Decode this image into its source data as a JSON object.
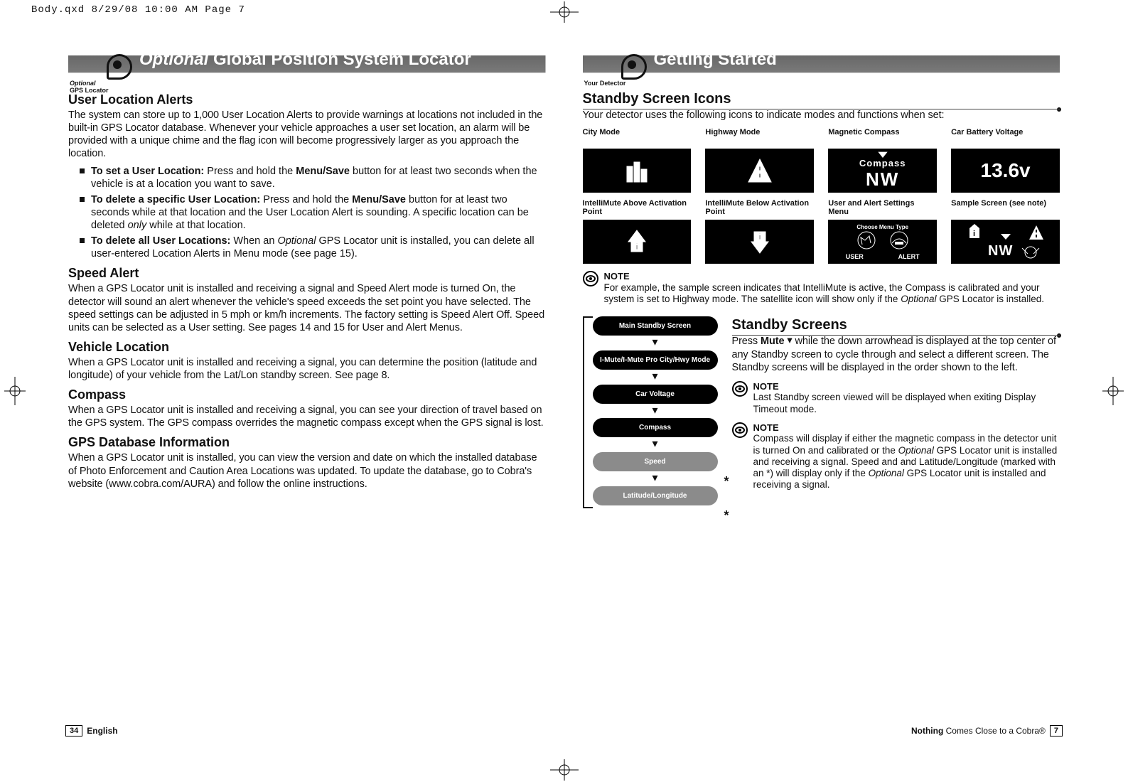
{
  "slug": "Body.qxd  8/29/08  10:00 AM  Page 7",
  "left": {
    "header_prefix_italic": "Optional",
    "header_rest": " Global Position System Locator",
    "header_caption_italic": "Optional",
    "header_caption_rest": "GPS Locator",
    "s1_title": "User Location Alerts",
    "s1_intro": "The system can store up to 1,000 User Location Alerts to provide warnings at locations not included in the built-in GPS Locator database. Whenever your vehicle approaches a user set location, an alarm will be provided with a unique chime and the flag icon will become progressively larger as you approach the location.",
    "s1_items": [
      {
        "lead": "To set a User Location:",
        "rest": " Press and hold the ",
        "mid_b": "Menu/Save",
        "rest2": " button for at least two seconds when the vehicle is at a location you want to save."
      },
      {
        "lead": "To delete a specific User Location:",
        "rest": " Press and hold the ",
        "mid_b": "Menu/Save",
        "rest2": " button for at least two seconds while at that location and the User Location Alert is sounding. A specific location can be deleted ",
        "ital": "only",
        "rest3": " while at that location."
      },
      {
        "lead": "To delete all User Locations:",
        "rest": " When an ",
        "ital": "Optional",
        "rest2": " GPS Locator unit is installed, you can delete all user-entered Location Alerts in Menu mode (see  page 15)."
      }
    ],
    "s2_title": "Speed Alert",
    "s2_body": "When a GPS Locator unit is installed and receiving a signal and Speed Alert mode is turned On, the detector will sound an alert whenever the vehicle's speed exceeds the set point you have selected. The speed settings can be adjusted in 5 mph or km/h increments. The factory setting is Speed Alert Off. Speed units can be selected as a User setting. See pages 14 and 15 for User and Alert Menus.",
    "s3_title": "Vehicle Location",
    "s3_body": "When a GPS Locator unit is installed and receiving a signal, you can determine the position (latitude and longitude) of your vehicle from the Lat/Lon standby screen. See page 8.",
    "s4_title": "Compass",
    "s4_body": "When a GPS Locator unit is installed and receiving a signal, you can see your direction of travel based on the GPS system. The GPS compass overrides the magnetic compass except when the GPS signal is lost.",
    "s5_title": "GPS Database Information",
    "s5_body": "When a GPS Locator unit is installed, you can view the version and date on which the installed database of Photo Enforcement and Caution Area Locations was updated. To update the database, go to Cobra's website (www.cobra.com/AURA) and follow the online instructions.",
    "footer_page": "34",
    "footer_lang": "English"
  },
  "right": {
    "header_title": "Getting Started",
    "header_caption": "Your Detector",
    "h1": "Standby Screen Icons",
    "h1_sub": "Your detector uses the following icons to indicate modes and functions when set:",
    "icons": {
      "city": "City Mode",
      "highway": "Highway Mode",
      "mag_compass": "Magnetic Compass",
      "battery": "Car Battery Voltage",
      "battery_value": "13.6v",
      "compass_lbl": "Compass",
      "compass_dir": "NW",
      "imute_above": "IntelliMute Above Activation Point",
      "imute_below": "IntelliMute Below Activation Point",
      "user_alert": "User and Alert Settings  Menu",
      "sample": "Sample Screen (see note)",
      "choose": "Choose Menu Type",
      "user_lbl": "USER",
      "alert_lbl": "ALERT"
    },
    "note1_hdr": "NOTE",
    "note1_body_a": "For example, the sample screen indicates that IntelliMute is active, the Compass is calibrated and your system is set to Highway mode. The satellite icon will show only if the ",
    "note1_body_ital": "Optional",
    "note1_body_b": " GPS Locator is installed.",
    "h2": "Standby Screens",
    "h2_body_a": "Press ",
    "h2_body_mute": "Mute",
    "h2_body_b": "  while the down arrowhead is displayed at the top center of any Standby screen to cycle through and select a different screen. The Standby screens will be displayed in the order shown to the left.",
    "note2_hdr": "NOTE",
    "note2_body": "Last Standby screen viewed will be displayed when exiting Display Timeout mode.",
    "note3_hdr": "NOTE",
    "note3_body_a": "Compass will display if either the magnetic compass in the detector unit is turned On and calibrated or the ",
    "note3_body_ital": "Optional",
    "note3_body_b": " GPS Locator unit is installed and receiving a signal. Speed and and Latitude/Longitude (marked with an *) will display only if the ",
    "note3_body_ital2": "Optional",
    "note3_body_c": " GPS Locator unit is installed and receiving a signal.",
    "flow": [
      {
        "label": "Main Standby Screen",
        "gray": false
      },
      {
        "label": "I-Mute/I-Mute Pro City/Hwy Mode",
        "gray": false
      },
      {
        "label": "Car Voltage",
        "gray": false
      },
      {
        "label": "Compass",
        "gray": false
      },
      {
        "label": "Speed",
        "gray": true,
        "star": true
      },
      {
        "label": "Latitude/Longitude",
        "gray": true,
        "star": true
      }
    ],
    "footer_tag_b": "Nothing",
    "footer_tag_rest": " Comes Close to a Cobra®",
    "footer_page": "7"
  }
}
